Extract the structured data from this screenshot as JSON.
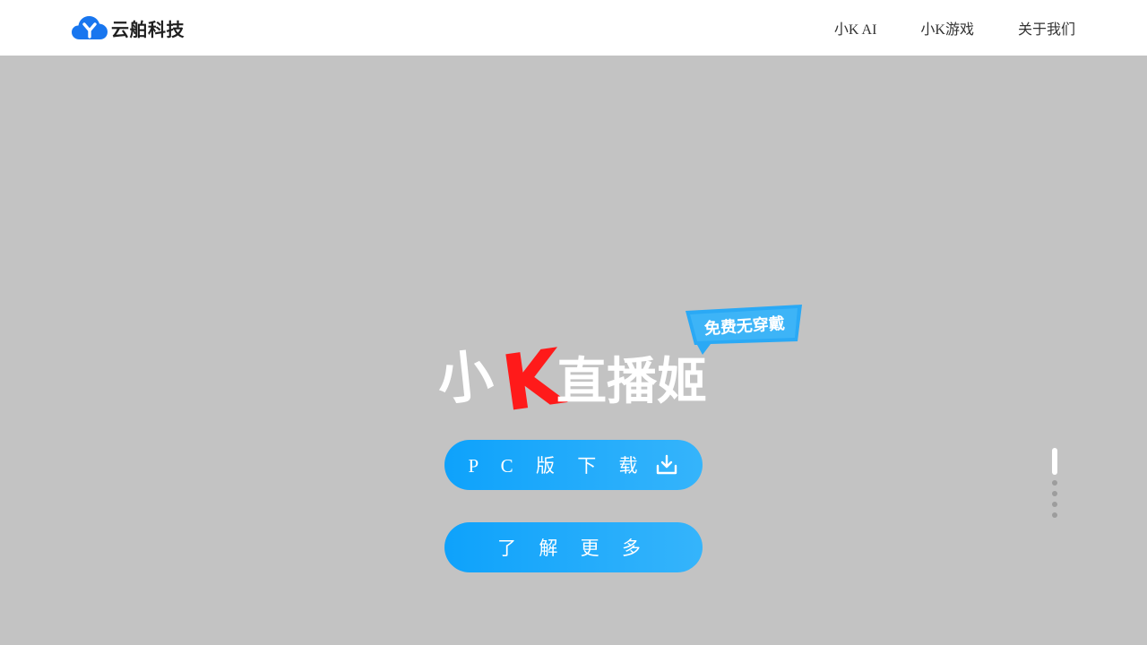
{
  "header": {
    "brand_name": "云舶科技",
    "nav": [
      "小K AI",
      "小K游戏",
      "关于我们"
    ]
  },
  "hero": {
    "product_logo": {
      "text_xiao": "小",
      "text_k": "K",
      "text_rest": "直播姬",
      "badge": "免费无穿戴"
    },
    "download_button": "P C 版 下 载",
    "more_button": "了 解 更 多",
    "pager": {
      "total": 5,
      "current": 1
    }
  },
  "colors": {
    "background": "#c3c3c3",
    "accent": "#0ea2fb",
    "logo_k_red": "#ff1a1a",
    "badge_blue": "#2aa9f5"
  },
  "icons": [
    "cloud-y-icon",
    "download-icon"
  ]
}
